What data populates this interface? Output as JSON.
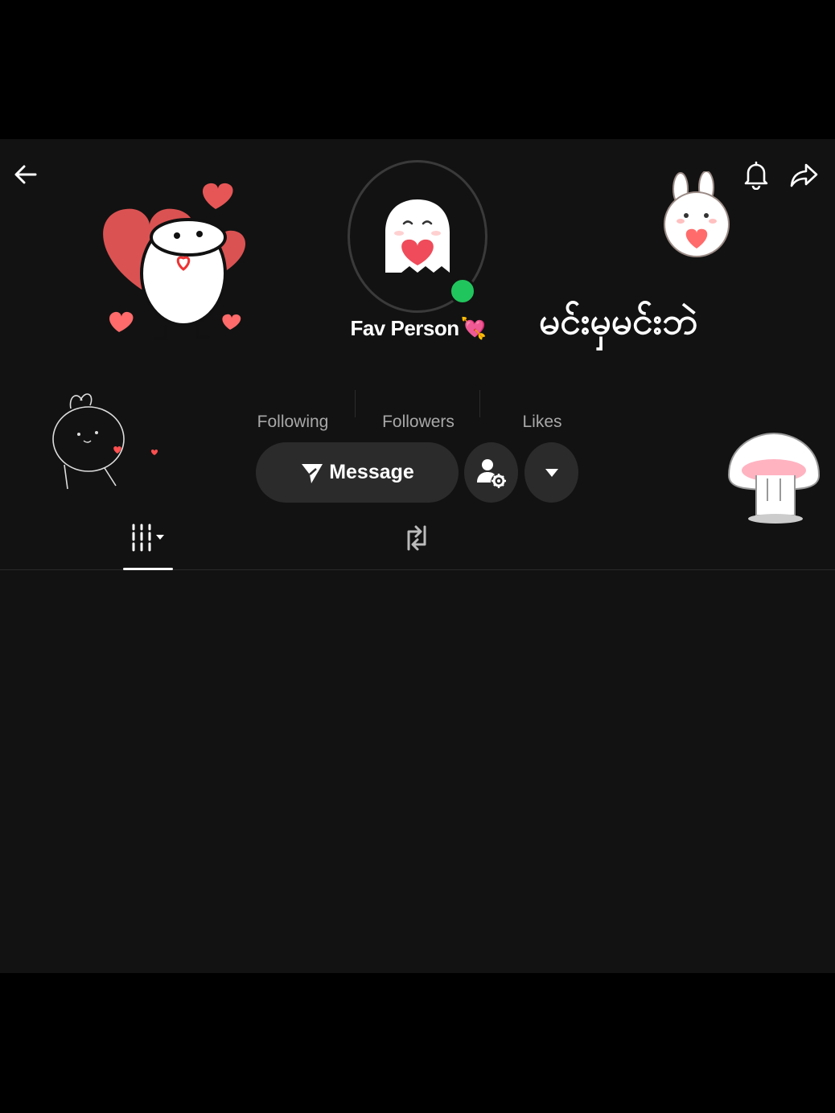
{
  "profile": {
    "name": "Fav Person",
    "name_emoji": "💘",
    "bio_myanmar": "မင်းမှမင်းဘဲ",
    "online": true
  },
  "stats": {
    "following": {
      "count": "",
      "label": "Following"
    },
    "followers": {
      "count": "",
      "label": "Followers"
    },
    "likes": {
      "count": "",
      "label": "Likes"
    }
  },
  "actions": {
    "message_label": "Message"
  },
  "icons": {
    "back": "back-arrow-icon",
    "notifications": "bell-icon",
    "share": "share-icon",
    "message": "send-icon",
    "friend_settings": "user-settings-icon",
    "more": "dropdown-icon",
    "tab_videos": "grid-icon",
    "tab_reposts": "repost-icon"
  },
  "colors": {
    "background": "#121212",
    "button": "#2b2b2b",
    "online": "#21c55d",
    "accent_heart": "#ff5fa2"
  }
}
